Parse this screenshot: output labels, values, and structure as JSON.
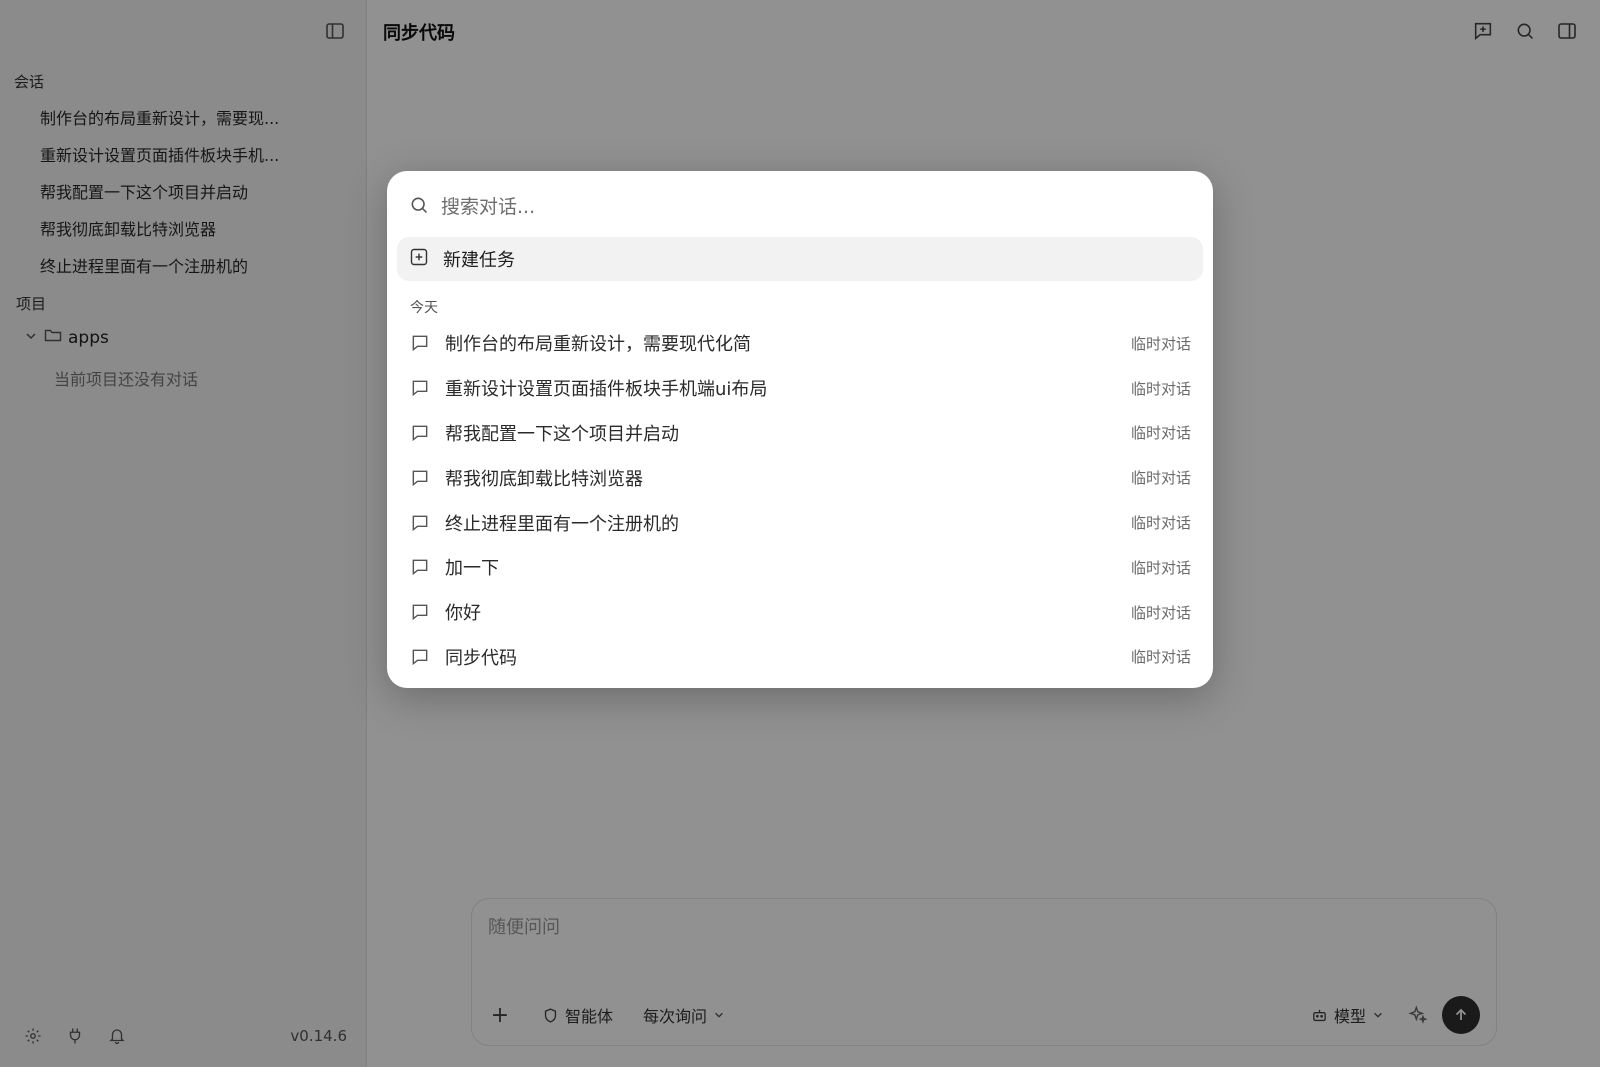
{
  "header": {
    "title": "同步代码"
  },
  "sidebar": {
    "sessions_label": "会话",
    "sessions": [
      {
        "title": "制作台的布局重新设计，需要现..."
      },
      {
        "title": "重新设计设置页面插件板块手机..."
      },
      {
        "title": "帮我配置一下这个项目并启动"
      },
      {
        "title": "帮我彻底卸载比特浏览器"
      },
      {
        "title": "终止进程里面有一个注册机的"
      }
    ],
    "projects_label": "项目",
    "project": {
      "name": "apps",
      "empty_text": "当前项目还没有对话"
    },
    "version": "v0.14.6"
  },
  "composer": {
    "placeholder": "随便问问",
    "agent_label": "智能体",
    "permission_label": "每次询问",
    "model_label": "模型"
  },
  "search_modal": {
    "placeholder": "搜索对话...",
    "new_task_label": "新建任务",
    "group_label": "今天",
    "conversations": [
      {
        "title": "制作台的布局重新设计，需要现代化简",
        "tag": "临时对话"
      },
      {
        "title": "重新设计设置页面插件板块手机端ui布局",
        "tag": "临时对话"
      },
      {
        "title": "帮我配置一下这个项目并启动",
        "tag": "临时对话"
      },
      {
        "title": "帮我彻底卸载比特浏览器",
        "tag": "临时对话"
      },
      {
        "title": "终止进程里面有一个注册机的",
        "tag": "临时对话"
      },
      {
        "title": "加一下",
        "tag": "临时对话"
      },
      {
        "title": "你好",
        "tag": "临时对话"
      },
      {
        "title": "同步代码",
        "tag": "临时对话"
      }
    ]
  },
  "theme": {
    "overlay": "#00000070",
    "send_button": "#2f2f2f",
    "sidebar_bg": "#f4f4f4"
  }
}
